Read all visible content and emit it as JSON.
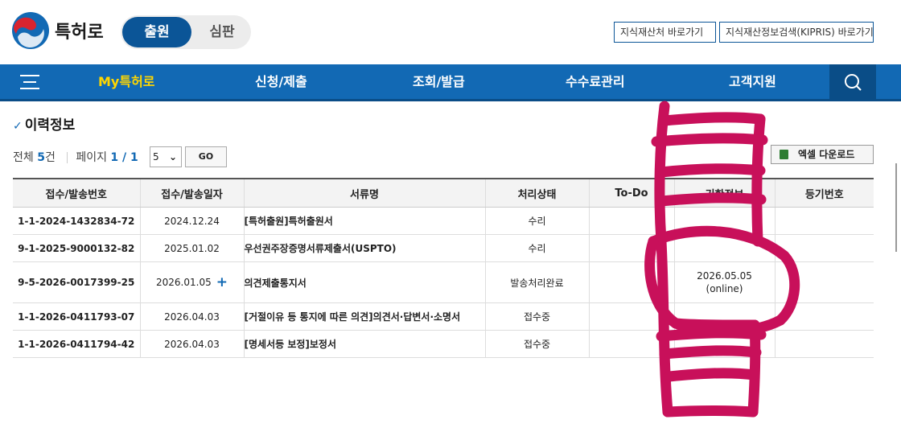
{
  "header": {
    "brand": "특허로",
    "mode_active": "출원",
    "mode_inactive": "심판",
    "links": [
      "지식재산처 바로가기",
      "지식재산정보검색(KIPRIS) 바로가기"
    ]
  },
  "nav": {
    "items": [
      "My특허로",
      "신청/제출",
      "조회/발급",
      "수수료관리",
      "고객지원"
    ]
  },
  "page": {
    "title_mark": "✓",
    "title": "이력정보",
    "total_label": "전체",
    "total_count": "5",
    "total_unit": "건",
    "page_label": "페이지",
    "page_current": "1",
    "page_sep": " / ",
    "page_total": "1",
    "page_size": "5",
    "go_label": "GO",
    "excel_label": "엑셀 다운로드"
  },
  "table": {
    "headers": [
      "접수/발송번호",
      "접수/발송일자",
      "서류명",
      "처리상태",
      "To-Do",
      "기한정보",
      "등기번호"
    ],
    "rows": [
      {
        "no": "1-1-2024-1432834-72",
        "date": "2024.12.24",
        "doc": "[특허출원]특허출원서",
        "status": "수리",
        "todo": "",
        "deadline": "",
        "deadline_sub": "",
        "reg": ""
      },
      {
        "no": "9-1-2025-9000132-82",
        "date": "2025.01.02",
        "doc": "우선권주장증명서류제출서(USPTO)",
        "status": "수리",
        "todo": "",
        "deadline": "",
        "deadline_sub": "",
        "reg": ""
      },
      {
        "no": "9-5-2026-0017399-25",
        "date": "2026.01.05",
        "doc": "의견제출통지서",
        "status": "발송처리완료",
        "todo": "",
        "deadline": "2026.05.05",
        "deadline_sub": "(online)",
        "reg": ""
      },
      {
        "no": "1-1-2026-0411793-07",
        "date": "2026.04.03",
        "doc": "[거절이유 등 통지에 따른 의견]의견서·답변서·소명서",
        "status": "접수중",
        "todo": "",
        "deadline": "",
        "deadline_sub": "",
        "reg": ""
      },
      {
        "no": "1-1-2026-0411794-42",
        "date": "2026.04.03",
        "doc": "[명세서등 보정]보정서",
        "status": "접수중",
        "todo": "",
        "deadline": "",
        "deadline_sub": "",
        "reg": ""
      }
    ],
    "row2_plus": "+"
  },
  "colors": {
    "primary": "#1269b4",
    "nav_active": "#ffd600",
    "toggle_active": "#0b5597",
    "annotation": "#c8105a"
  },
  "icons": [
    "government-emblem-logo",
    "hamburger-menu-icon",
    "search-icon",
    "excel-icon",
    "chevron-down-icon",
    "plus-icon"
  ]
}
